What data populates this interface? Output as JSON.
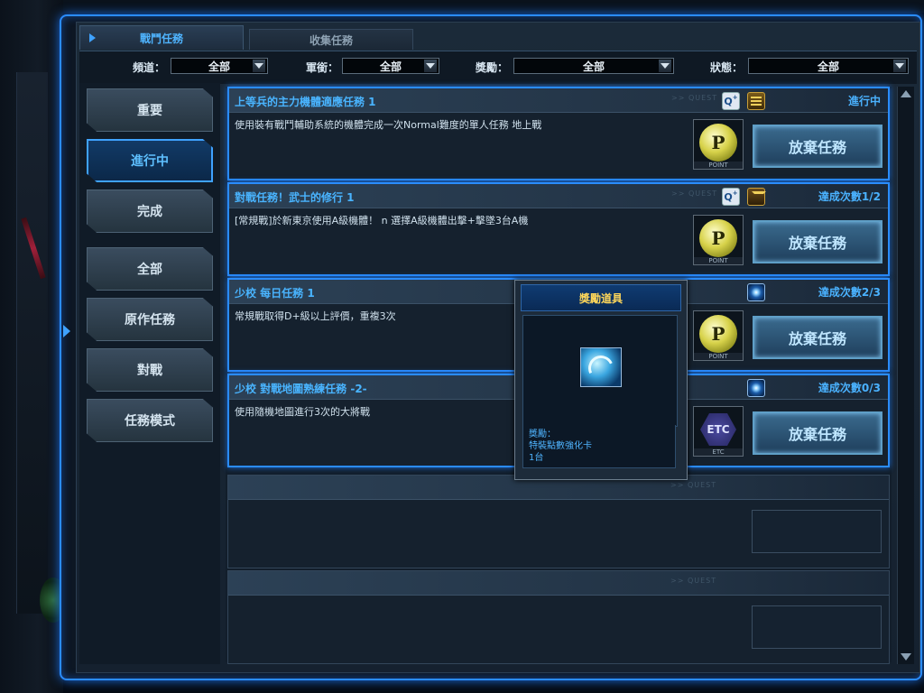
{
  "tabs": [
    {
      "label": "戰鬥任務",
      "active": true
    },
    {
      "label": "收集任務",
      "active": false
    }
  ],
  "filters": [
    {
      "label": "頻道：",
      "value": "全部"
    },
    {
      "label": "軍銜：",
      "value": "全部"
    },
    {
      "label": "獎勵：",
      "value": "全部"
    },
    {
      "label": "狀態：",
      "value": "全部"
    }
  ],
  "sidebar": {
    "items": [
      {
        "label": "重要",
        "active": false
      },
      {
        "label": "進行中",
        "active": true
      },
      {
        "label": "完成",
        "active": false
      },
      {
        "label": "全部",
        "active": false
      },
      {
        "label": "原作任務",
        "active": false
      },
      {
        "label": "對戰",
        "active": false
      },
      {
        "label": "任務模式",
        "active": false
      }
    ]
  },
  "missions": [
    {
      "title": "上等兵的主力機體適應任務  1",
      "description": "使用裝有戰鬥輔助系統的機體完成一次Normal難度的單人任務 地上戰",
      "status": "進行中",
      "icons": [
        "quest-plus-icon",
        "gold-stripes-icon"
      ],
      "reward_icon": "point-coin-icon",
      "reward_symbol": "P",
      "reward_caption": "POINT",
      "button": "放棄任務"
    },
    {
      "title": "對戰任務！武士的修行  1",
      "description": "[常規戰]於新東京使用A級機體！ n 選擇A級機體出擊+擊墜3台A機",
      "status": "達成次數1/2",
      "icons": [
        "quest-plus-icon",
        "rank-chevron-icon"
      ],
      "reward_icon": "point-coin-icon",
      "reward_symbol": "P",
      "reward_caption": "POINT",
      "button": "放棄任務"
    },
    {
      "title": "少校  每日任務  1",
      "description": "常規戰取得D+級以上評價，重複3次",
      "status": "達成次數2/3",
      "icons": [
        "daily-star-icon"
      ],
      "reward_icon": "point-coin-icon",
      "reward_symbol": "P",
      "reward_caption": "POINT",
      "button": "放棄任務"
    },
    {
      "title": "少校  對戰地圖熟練任務  -2-",
      "description": "使用隨機地圖進行3次的大將戰",
      "status": "達成次數0/3",
      "icons": [
        "daily-star-icon"
      ],
      "reward_icon": "etc-item-icon",
      "reward_symbol": "ETC",
      "reward_caption": "ETC",
      "button": "放棄任務"
    }
  ],
  "quest_tag": ">> QUEST",
  "popup": {
    "title": "獎勵道具",
    "line1": "獎勵：",
    "line2": "特裝點數強化卡",
    "line3": "1台"
  },
  "colors": {
    "accent": "#2a8cff",
    "title": "#49b4ff",
    "gold": "#ffd75a"
  }
}
